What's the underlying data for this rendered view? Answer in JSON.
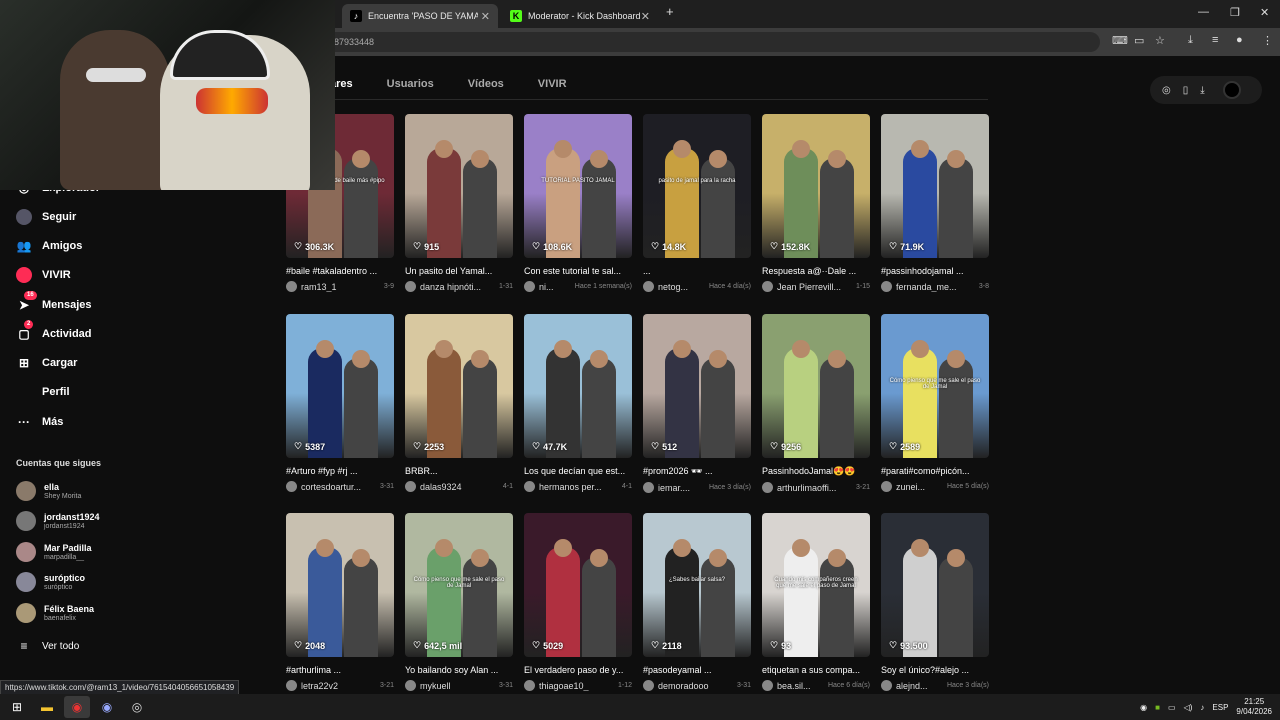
{
  "browser": {
    "tabs": [
      {
        "label": "Encuentra 'PASO DE YAMAL' en",
        "icon": "tiktok-icon",
        "active": true
      },
      {
        "label": "Moderator - Kick Dashboard",
        "icon": "kick-icon",
        "active": false
      }
    ],
    "url_visible": "87933448"
  },
  "search_tabs": [
    "ares",
    "Usuarios",
    "Vídeos",
    "VIVIR"
  ],
  "sidebar": {
    "items": [
      {
        "label": "Explorador",
        "icon": "compass-icon"
      },
      {
        "label": "Seguir",
        "icon": "following-avatar-icon"
      },
      {
        "label": "Amigos",
        "icon": "friends-icon"
      },
      {
        "label": "VIVIR",
        "icon": "live-icon"
      },
      {
        "label": "Mensajes",
        "icon": "send-icon",
        "badge": "16"
      },
      {
        "label": "Actividad",
        "icon": "activity-icon",
        "badge": "2"
      },
      {
        "label": "Cargar",
        "icon": "upload-icon"
      },
      {
        "label": "Perfil",
        "icon": "profile-icon"
      },
      {
        "label": "Más",
        "icon": "more-icon"
      }
    ],
    "following_title": "Cuentas que sigues",
    "following": [
      {
        "name": "ella",
        "user": "Shey Morita"
      },
      {
        "name": "jordanst1924",
        "user": "jordanst1924"
      },
      {
        "name": "Mar Padilla",
        "user": "marpadilla__"
      },
      {
        "name": "suróptico",
        "user": "suróptico"
      },
      {
        "name": "Félix Baena",
        "user": "baenafelix"
      }
    ],
    "see_all": "Ver todo"
  },
  "videos": [
    {
      "likes": "306.3K",
      "caption": "#baile #takaladentro ...",
      "user": "ram13_1",
      "date": "3-9",
      "overlay": "POV: Tu paso de baile más #pipo"
    },
    {
      "likes": "915",
      "caption": "Un pasito del Yamal...",
      "user": "danza hipnóti...",
      "date": "1-31",
      "overlay": ""
    },
    {
      "likes": "108.6K",
      "caption": "Con este tutorial te sal...",
      "user": "ni...",
      "date": "Hace 1 semana(s)",
      "overlay": "TUTORIAL PASITO JAMAL"
    },
    {
      "likes": "14.8K",
      "caption": "...",
      "user": "netog...",
      "date": "Hace 4 día(s)",
      "overlay": "pasito de jamal para la racha"
    },
    {
      "likes": "152.8K",
      "caption": "Respuesta a@··Dale ...",
      "user": "Jean Pierrevill...",
      "date": "1-15",
      "overlay": ""
    },
    {
      "likes": "71.9K",
      "caption": "#passinhodojamal ...",
      "user": "fernanda_me...",
      "date": "3-8",
      "overlay": ""
    },
    {
      "likes": "5387",
      "caption": "#Arturo #fyp #rj ...",
      "user": "cortesdoartur...",
      "date": "3-31",
      "overlay": ""
    },
    {
      "likes": "2253",
      "caption": "BRBR...",
      "user": "dalas9324",
      "date": "4-1",
      "overlay": ""
    },
    {
      "likes": "47.7K",
      "caption": "Los que decían que est...",
      "user": "hermanos per...",
      "date": "4-1",
      "overlay": ""
    },
    {
      "likes": "512",
      "caption": "#prom2026 🕶 ...",
      "user": "iemar....",
      "date": "Hace 3 día(s)",
      "overlay": ""
    },
    {
      "likes": "9256",
      "caption": "PassinhodoJamal😍😍",
      "user": "arthurlimaoffi...",
      "date": "3-21",
      "overlay": ""
    },
    {
      "likes": "2589",
      "caption": "#parati#como#picón...",
      "user": "zunei...",
      "date": "Hace 5 día(s)",
      "overlay": "Cómo pienso que me sale el paso de Jamal"
    },
    {
      "likes": "2048",
      "caption": "#arthurlima ...",
      "user": "letra22v2",
      "date": "3-21",
      "overlay": ""
    },
    {
      "likes": "642,5 mil",
      "caption": "Yo bailando soy Alan ...",
      "user": "mykuell",
      "date": "3-31",
      "overlay": "Cómo pienso que me sale el paso de Jamal"
    },
    {
      "likes": "5029",
      "caption": "El verdadero paso de y...",
      "user": "thiagoae10_",
      "date": "1-12",
      "overlay": ""
    },
    {
      "likes": "2118",
      "caption": "#pasodeyamal ...",
      "user": "demoradooo",
      "date": "3-31",
      "overlay": "¿Sabes bailar salsa?"
    },
    {
      "likes": "93",
      "caption": "etiquetan a sus compa...",
      "user": "bea.sil...",
      "date": "Hace 6 día(s)",
      "overlay": "Cuando mis compañeros creen que me sale el paso de Jamal"
    },
    {
      "likes": "93.500",
      "caption": "Soy el único?#alejo ...",
      "user": "alejnd...",
      "date": "Hace 3 día(s)",
      "overlay": ""
    }
  ],
  "status_url": "https://www.tiktok.com/@ram13_1/video/7615404056651058439",
  "taskbar": {
    "lang": "ESP",
    "time": "21:25",
    "date": "9/04/2026"
  },
  "colors": {
    "accent": "#fe2c55",
    "bg": "#0e0e0e"
  }
}
